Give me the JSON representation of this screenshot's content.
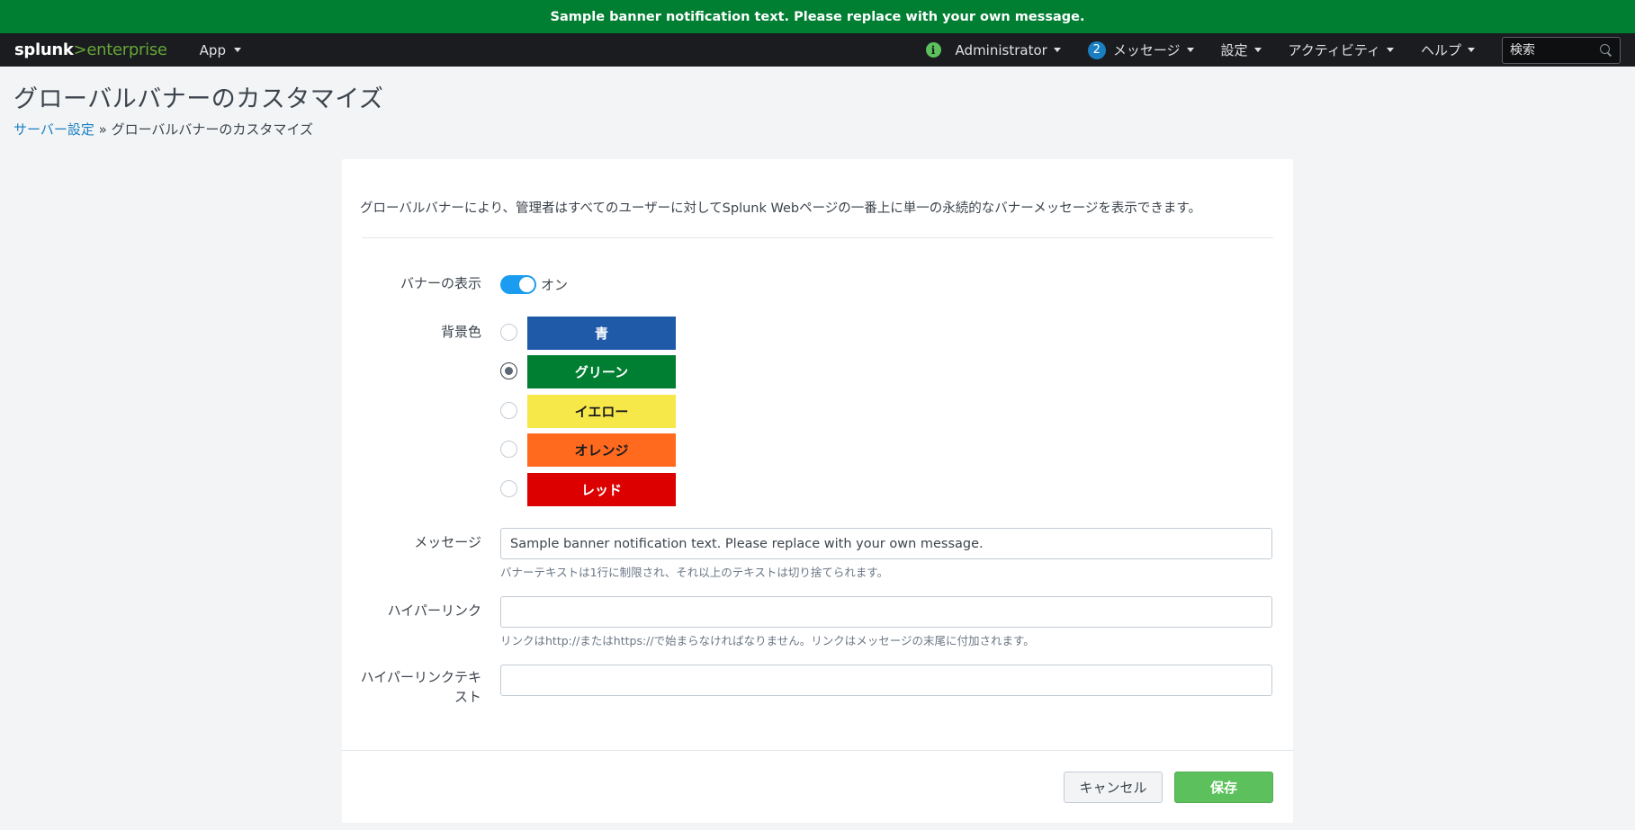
{
  "global_banner": {
    "text": "Sample banner notification text. Please replace with your own message."
  },
  "topnav": {
    "logo_part1": "splunk",
    "logo_part2": ">",
    "logo_part3": "enterprise",
    "app_menu": "App",
    "status_glyph": "i",
    "user": "Administrator",
    "messages_count": "2",
    "messages": "メッセージ",
    "settings": "設定",
    "activity": "アクティビティ",
    "help": "ヘルプ",
    "search_placeholder": "検索"
  },
  "page": {
    "title": "グローバルバナーのカスタマイズ",
    "breadcrumb_link": "サーバー設定",
    "breadcrumb_sep": " » ",
    "breadcrumb_current": "グローバルバナーのカスタマイズ"
  },
  "form": {
    "intro": "グローバルバナーにより、管理者はすべてのユーザーに対してSplunk Webページの一番上に単一の永続的なバナーメッセージを表示できます。",
    "show_banner_label": "バナーの表示",
    "show_banner_state": "オン",
    "bg_color_label": "背景色",
    "colors": [
      {
        "label": "青",
        "bg": "#1e5aa8",
        "fg": "#ffffff",
        "selected": false
      },
      {
        "label": "グリーン",
        "bg": "#007f32",
        "fg": "#ffffff",
        "selected": true
      },
      {
        "label": "イエロー",
        "bg": "#f7e84a",
        "fg": "#1a1c20",
        "selected": false
      },
      {
        "label": "オレンジ",
        "bg": "#ff6a1f",
        "fg": "#1a1c20",
        "selected": false
      },
      {
        "label": "レッド",
        "bg": "#dc0000",
        "fg": "#ffffff",
        "selected": false
      }
    ],
    "message_label": "メッセージ",
    "message_value": "Sample banner notification text. Please replace with your own message.",
    "message_help": "バナーテキストは1行に制限され、それ以上のテキストは切り捨てられます。",
    "hyperlink_label": "ハイパーリンク",
    "hyperlink_value": "",
    "hyperlink_help": "リンクはhttp://またはhttps://で始まらなければなりません。リンクはメッセージの末尾に付加されます。",
    "hyperlink_text_label": "ハイパーリンクテキスト",
    "hyperlink_text_value": "",
    "cancel": "キャンセル",
    "save": "保存"
  }
}
